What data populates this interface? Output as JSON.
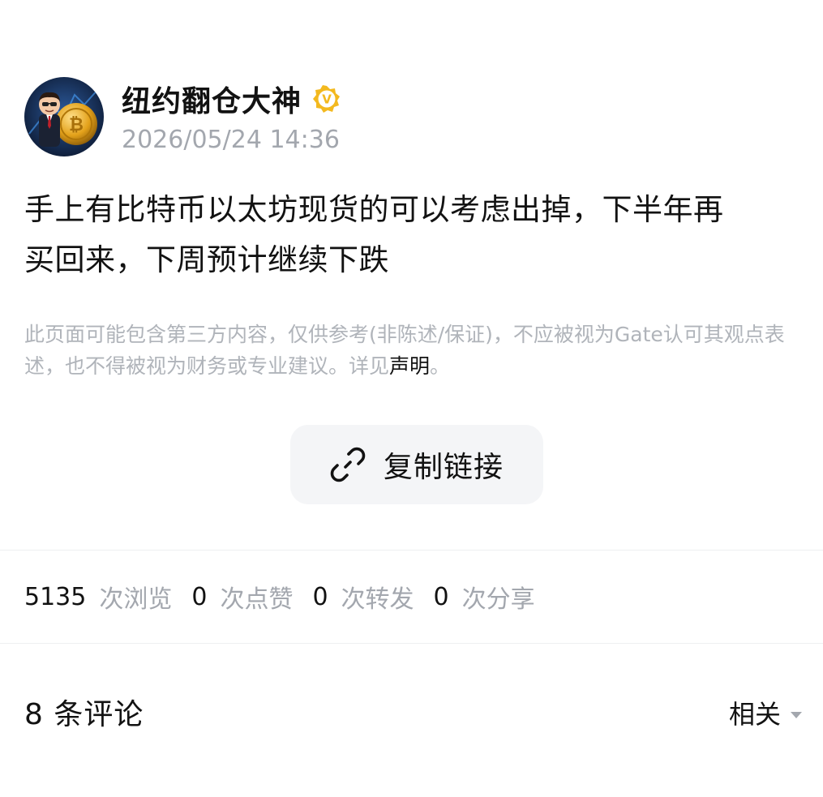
{
  "post": {
    "author": {
      "name": "纽约翻仓大神",
      "verified_badge": "V",
      "avatar_icon": "avatar-bitcoin-businessman"
    },
    "timestamp": "2026/05/24 14:36",
    "content_line1": "手上有比特币以太坊现货的可以考虑出掉，下半年再",
    "content_line2": "买回来，下周预计继续下跌"
  },
  "disclaimer": {
    "text": "此页面可能包含第三方内容，仅供参考(非陈述/保证)，不应被视为Gate认可其观点表述，也不得被视为财务或专业建议。详见",
    "link": "声明",
    "tail": "。"
  },
  "actions": {
    "copy_link_label": "复制链接",
    "copy_link_icon": "link-icon"
  },
  "stats": {
    "views": "5135",
    "views_label": "次浏览",
    "likes": "0",
    "likes_label": "次点赞",
    "reposts": "0",
    "reposts_label": "次转发",
    "shares": "0",
    "shares_label": "次分享"
  },
  "comments": {
    "title": "8 条评论",
    "sort_label": "相关",
    "sort_icon": "caret-down-icon"
  },
  "colors": {
    "text_primary": "#121212",
    "text_secondary": "#a3a7ae",
    "badge_gold": "#f3b91f",
    "button_bg": "#f4f5f7"
  }
}
